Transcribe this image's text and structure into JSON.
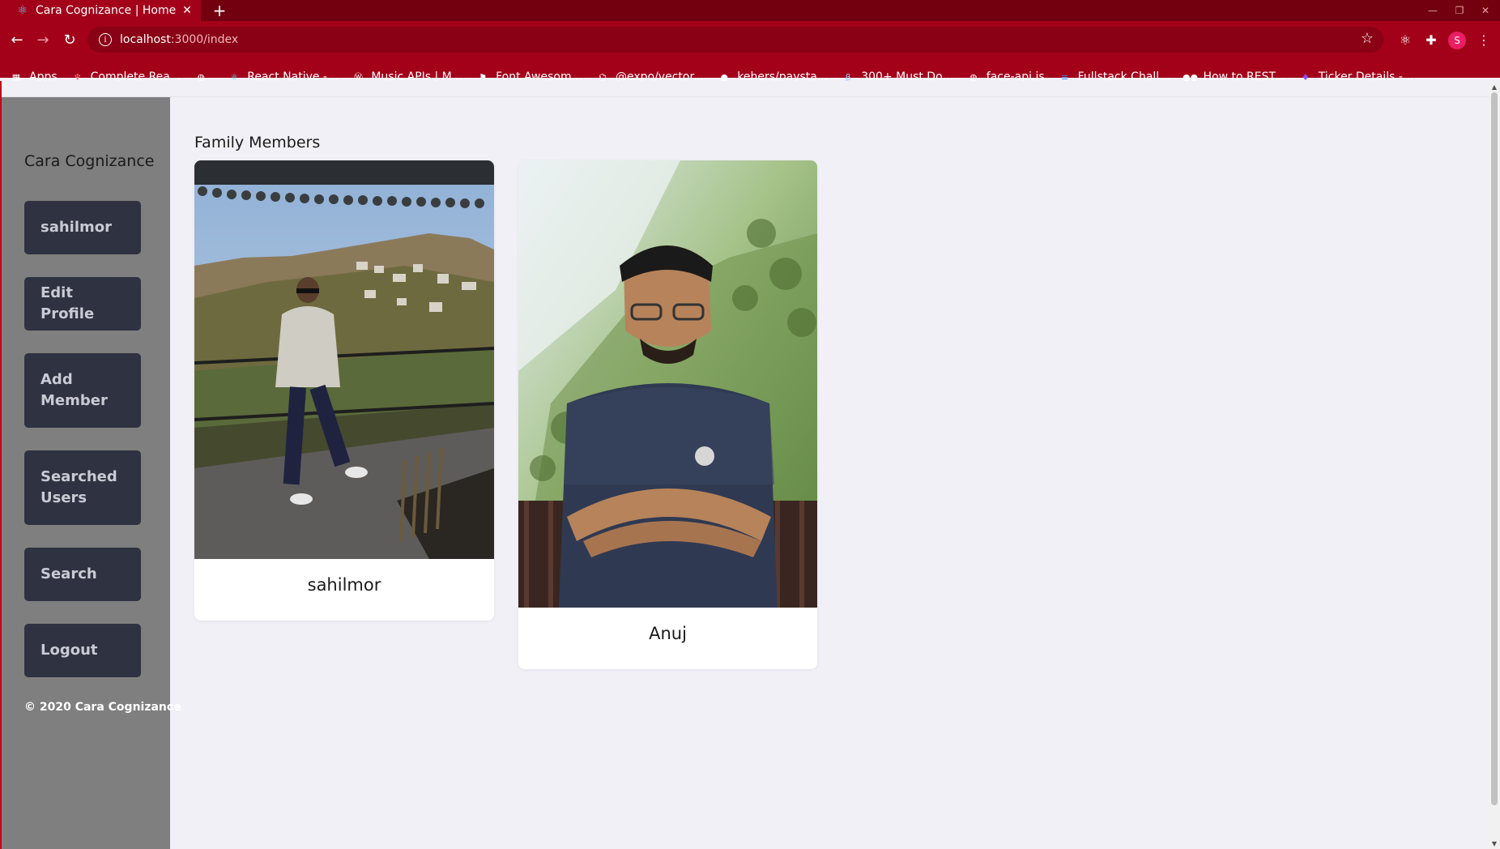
{
  "browser": {
    "tab_title": "Cara Cognizance | Home",
    "url_host": "localhost",
    "url_path": ":3000/index",
    "profile_initial": "S",
    "bookmarks": [
      {
        "label": "Apps",
        "icon": "apps-grid-icon",
        "color": "#ffffff"
      },
      {
        "label": "Complete Rea...",
        "icon": "bookmark-logo-icon",
        "color": "#ff7a7a"
      },
      {
        "label": "",
        "icon": "globe-icon",
        "color": "#ffffff"
      },
      {
        "label": "React Native -...",
        "icon": "react-icon",
        "color": "#61dafb"
      },
      {
        "label": "Music APIs | M...",
        "icon": "wordpress-icon",
        "color": "#ffffff"
      },
      {
        "label": "Font Awesom...",
        "icon": "flag-icon",
        "color": "#ffffff"
      },
      {
        "label": "@expo/vector...",
        "icon": "expo-icon",
        "color": "#ffffff"
      },
      {
        "label": "kehers/paysta...",
        "icon": "github-icon",
        "color": "#ffffff"
      },
      {
        "label": "300+ Must Do...",
        "icon": "beta-icon",
        "color": "#9ecbff"
      },
      {
        "label": "face-api.js",
        "icon": "globe-icon",
        "color": "#ffffff"
      },
      {
        "label": "Fullstack Chall...",
        "icon": "doc-icon",
        "color": "#4285f4"
      },
      {
        "label": "How to REST...",
        "icon": "medium-icon",
        "color": "#ffffff"
      },
      {
        "label": "Ticker Details -...",
        "icon": "bulb-icon",
        "color": "#8a4dff"
      }
    ]
  },
  "sidebar": {
    "brand": "Cara Cognizance",
    "items": [
      {
        "label": "sahilmor"
      },
      {
        "label": "Edit Profile"
      },
      {
        "label": "Add Member"
      },
      {
        "label": "Searched Users"
      },
      {
        "label": "Search"
      },
      {
        "label": "Logout"
      }
    ],
    "copyright": "© 2020 Cara Cognizance"
  },
  "main": {
    "section_title": "Family Members",
    "members": [
      {
        "name": "sahilmor"
      },
      {
        "name": "Anuj"
      }
    ]
  },
  "colors": {
    "browser_accent": "#a3001a",
    "sidebar_bg": "#7f7f7f",
    "nav_button_bg": "#2f3240",
    "page_bg": "#f1f0f6"
  }
}
